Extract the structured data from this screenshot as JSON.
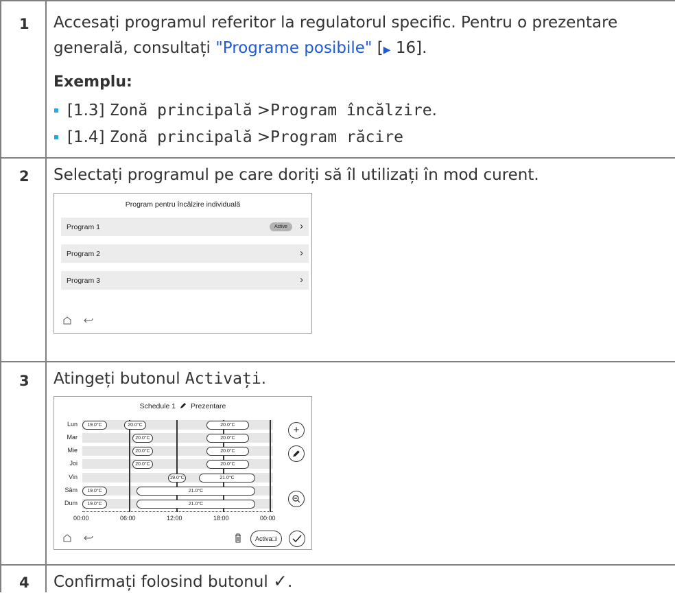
{
  "steps": [
    {
      "number": "1",
      "text_line1": "Accesați programul referitor la regulatorul specific. Pentru o prezentare",
      "text_line2_prefix": "generală, consultați ",
      "link_text": "\"Programe posibile\"",
      "ref_open": " [",
      "ref_arrow": "▶",
      "ref_page": " 16",
      "ref_close": "].",
      "example_heading": "Exemplu:",
      "examples": [
        {
          "code": "[1.3]",
          "path1": "Zonă principală",
          "sep": ">",
          "path2": "Program încălzire",
          "end": "."
        },
        {
          "code": "[1.4]",
          "path1": "Zonă principală",
          "sep": ">",
          "path2": "Program răcire",
          "end": ""
        }
      ]
    },
    {
      "number": "2",
      "text": "Selectați programul pe care doriți să îl utilizați în mod curent."
    },
    {
      "number": "3",
      "text_prefix": "Atingeți butonul ",
      "text_code": "Activați",
      "text_suffix": "."
    },
    {
      "number": "4",
      "text_prefix": "Confirmați folosind butonul ",
      "text_check": "✓",
      "text_suffix": "."
    }
  ],
  "screen1": {
    "title": "Program pentru încălzire individuală",
    "programs": [
      {
        "label": "Program 1",
        "badge": "Active"
      },
      {
        "label": "Program 2",
        "badge": ""
      },
      {
        "label": "Program 3",
        "badge": ""
      }
    ],
    "chevron": "›",
    "home_icon": "home-icon",
    "back_icon": "back-icon"
  },
  "screen2": {
    "title": "Schedule 1",
    "subtitle": "Prezentare",
    "edit_icon": "pencil-icon",
    "days": [
      "Lun",
      "Mar",
      "Mie",
      "Joi",
      "Vin",
      "Sâm",
      "Dum"
    ],
    "pills": {
      "lun_a": "19.0°C",
      "lun_b": "20.0°C",
      "lun_c": "20.0°C",
      "mar_a": "20.0°C",
      "mar_b": "20.0°C",
      "mie_a": "20.0°C",
      "mie_b": "20.0°C",
      "joi_a": "20.0°C",
      "joi_b": "20.0°C",
      "vin_a": "19.0°C",
      "vin_b": "21.0°C",
      "sam_a": "19.0°C",
      "sam_b": "21.0°C",
      "dum_a": "19.0°C",
      "dum_b": "21.0°C"
    },
    "ticks": [
      "00:00",
      "06:00",
      "12:00",
      "18:00",
      "00:00"
    ],
    "activate_label": "Activa□i",
    "side_buttons": [
      "plus-icon",
      "pencil-icon",
      "zoom-icon"
    ],
    "bottom_icons": [
      "home-icon",
      "back-icon",
      "trash-icon",
      "check-icon"
    ]
  }
}
